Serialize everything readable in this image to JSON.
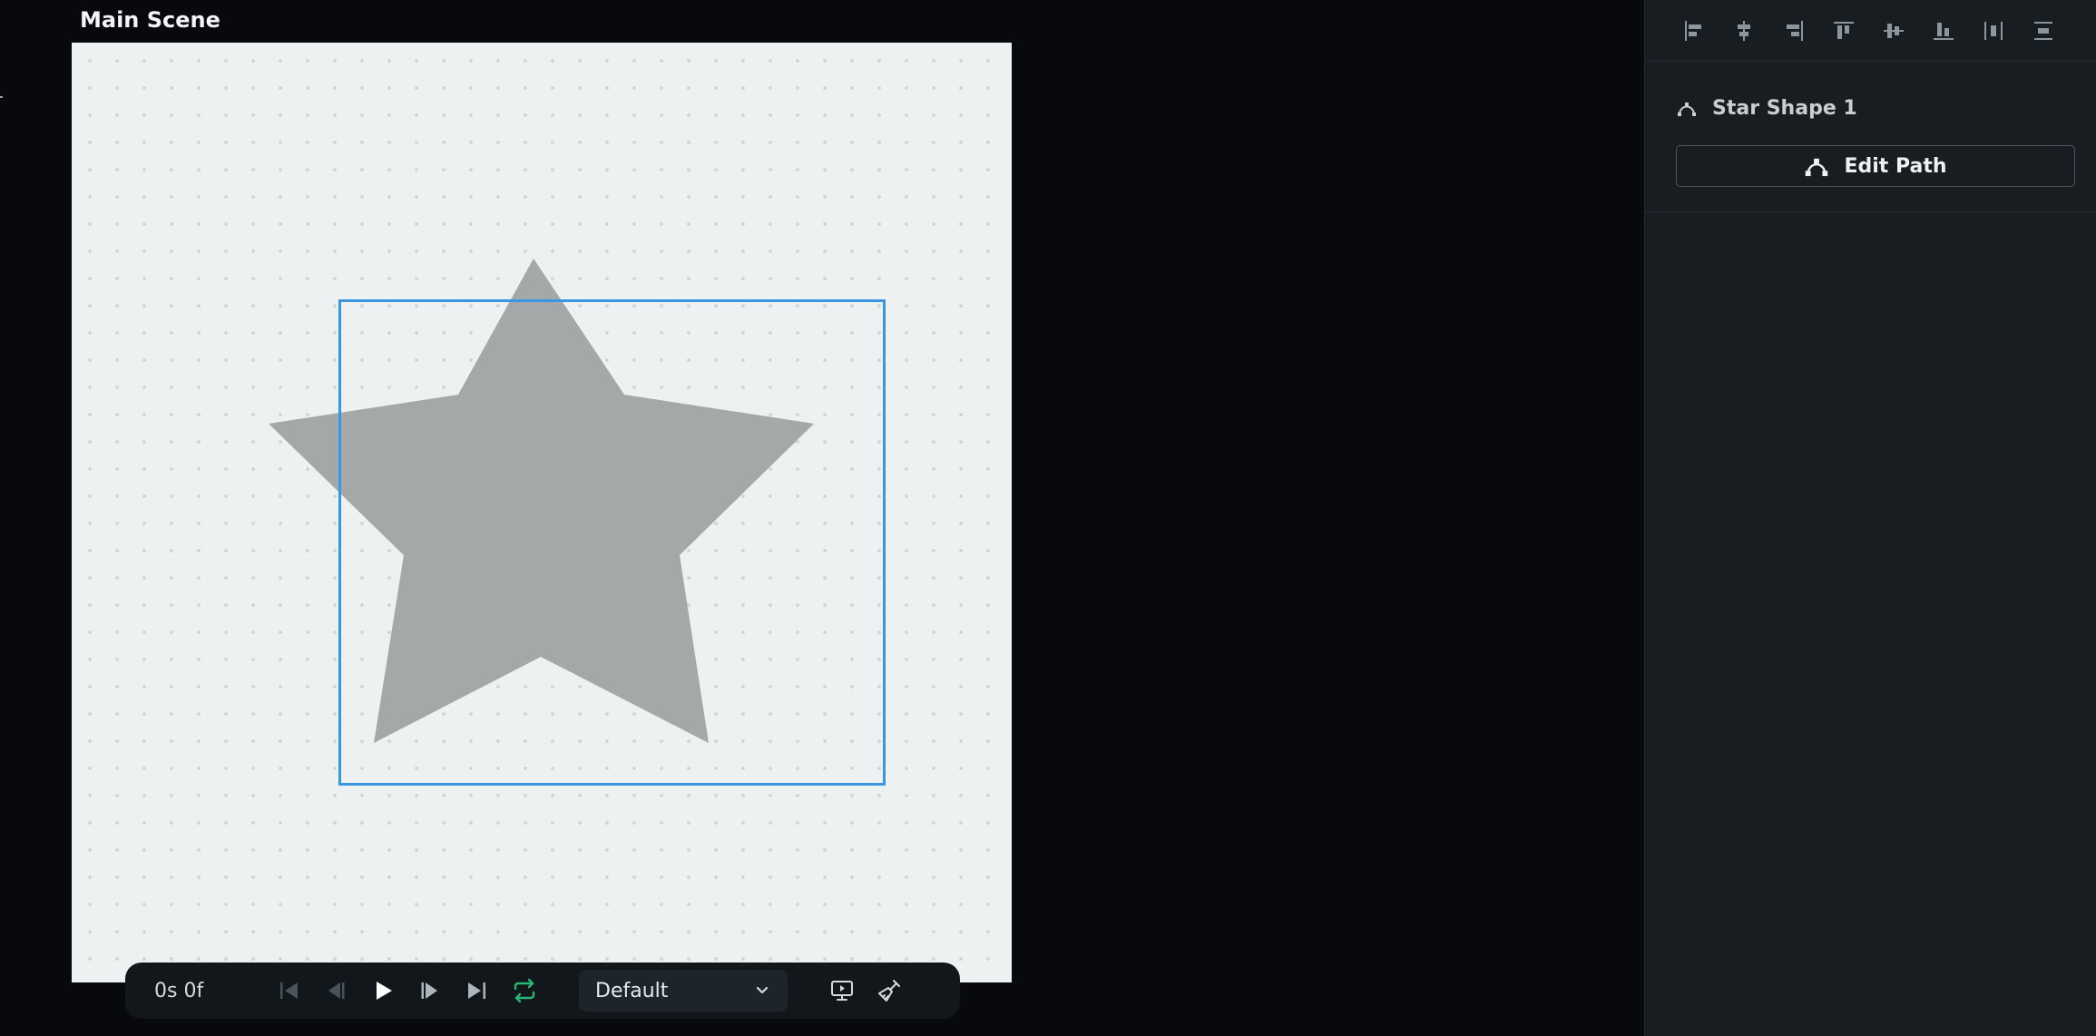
{
  "scene": {
    "title": "Main Scene"
  },
  "canvas": {
    "background": "#edf1f1",
    "dot_color": "#cdd5d8"
  },
  "shape": {
    "fill": "#a4a8a9",
    "selection_color": "#3b95e0"
  },
  "playback": {
    "time": "0s 0f",
    "scene_select_value": "Default",
    "controls": [
      "skip-start-icon",
      "step-back-icon",
      "play-icon",
      "step-forward-icon",
      "skip-end-icon",
      "loop-icon",
      "preview-icon",
      "clear-icon"
    ],
    "loop_color": "#2bb673"
  },
  "panel": {
    "align_tools": [
      "align-left-icon",
      "align-center-h-icon",
      "align-right-icon",
      "align-top-icon",
      "align-middle-v-icon",
      "align-bottom-icon",
      "distribute-h-icon",
      "distribute-v-icon"
    ],
    "layer_name": "Star Shape 1",
    "edit_path_label": "Edit Path"
  }
}
